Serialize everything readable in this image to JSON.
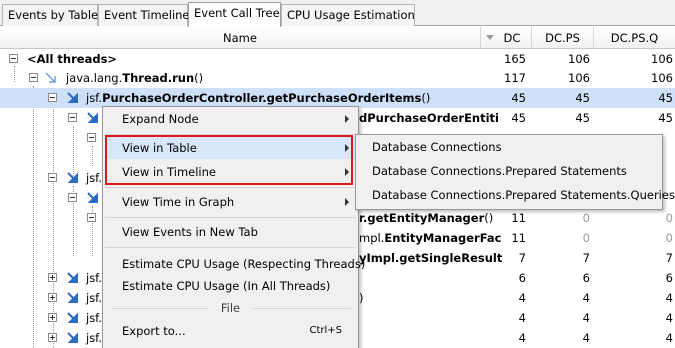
{
  "tabs": [
    {
      "label": "Events by Table"
    },
    {
      "label": "Event Timeline"
    },
    {
      "label": "Event Call Tree"
    },
    {
      "label": "CPU Usage Estimation"
    }
  ],
  "columns": {
    "name": "Name",
    "dc": "DC",
    "dcps": "DC.PS",
    "dcpsq": "DC.PS.Q"
  },
  "tree": [
    {
      "prefix": "",
      "bold": "<All threads>",
      "suffix": "",
      "dc": "165",
      "dcps": "106",
      "dcpsq": "106"
    },
    {
      "prefix": "java.lang.",
      "bold": "Thread.run",
      "suffix": "()",
      "dc": "117",
      "dcps": "106",
      "dcpsq": "106"
    },
    {
      "prefix": "jsf.",
      "bold": "PurchaseOrderController.getPurchaseOrderItems",
      "suffix": "()",
      "dc": "45",
      "dcps": "45",
      "dcpsq": "45"
    },
    {
      "prefix": "",
      "bold": "dPurchaseOrderEntiti",
      "suffix": "",
      "dc": "45",
      "dcps": "45",
      "dcpsq": "45"
    },
    {
      "prefix": "",
      "bold": "",
      "suffix": "",
      "dc": "",
      "dcps": "",
      "dcpsq": ""
    },
    {
      "prefix": "jsf.",
      "bold": "",
      "suffix": "",
      "dc": "",
      "dcps": "",
      "dcpsq": ""
    },
    {
      "prefix": "",
      "bold": "",
      "suffix": "",
      "dc": "",
      "dcps": "",
      "dcpsq": ""
    },
    {
      "prefix": "",
      "bold": "r.getEntityManager",
      "suffix": "()",
      "dc": "11",
      "dcps": "0",
      "dcpsq": "0"
    },
    {
      "prefix": "mpl.",
      "bold": "EntityManagerFac",
      "suffix": "",
      "dc": "11",
      "dcps": "0",
      "dcpsq": "0"
    },
    {
      "prefix": "",
      "bold": "yImpl.getSingleResult",
      "suffix": "",
      "dc": "7",
      "dcps": "7",
      "dcpsq": "7"
    },
    {
      "prefix": "jsf.",
      "bold": "",
      "suffix": "",
      "dc": "6",
      "dcps": "6",
      "dcpsq": "6"
    },
    {
      "prefix": "jsf.",
      "bold": "",
      "suffix": ")",
      "dc": "4",
      "dcps": "4",
      "dcpsq": "4"
    },
    {
      "prefix": "jsf.",
      "bold": "",
      "suffix": "",
      "dc": "4",
      "dcps": "4",
      "dcpsq": "4"
    },
    {
      "prefix": "jsf.",
      "bold": "",
      "suffix": "",
      "dc": "4",
      "dcps": "4",
      "dcpsq": "4"
    }
  ],
  "context_menu": {
    "expand_node": "Expand Node",
    "view_in_table": "View in Table",
    "view_in_timeline": "View in Timeline",
    "view_time_in_graph": "View Time in Graph",
    "view_events_new_tab": "View Events in New Tab",
    "estimate_cpu_respecting": "Estimate CPU Usage (Respecting Threads)",
    "estimate_cpu_all": "Estimate CPU Usage (In All Threads)",
    "file_section": "File",
    "export_to": "Export to...",
    "export_shortcut": "Ctrl+S"
  },
  "submenu": [
    {
      "label": "Database Connections"
    },
    {
      "label": "Database Connections.Prepared Statements"
    },
    {
      "label": "Database Connections.Prepared Statements.Queries"
    }
  ],
  "colors": {
    "selection": "#cde0f7",
    "menu_highlight": "#d7e6f8",
    "annotation_box": "#e0161d",
    "thread_icon": "#4a90d9"
  },
  "icons": {
    "expander": "tree-expander-icon",
    "thread": "thread-arrow-icon",
    "method": "method-arrow-icon",
    "submenu": "submenu-arrow-icon"
  }
}
